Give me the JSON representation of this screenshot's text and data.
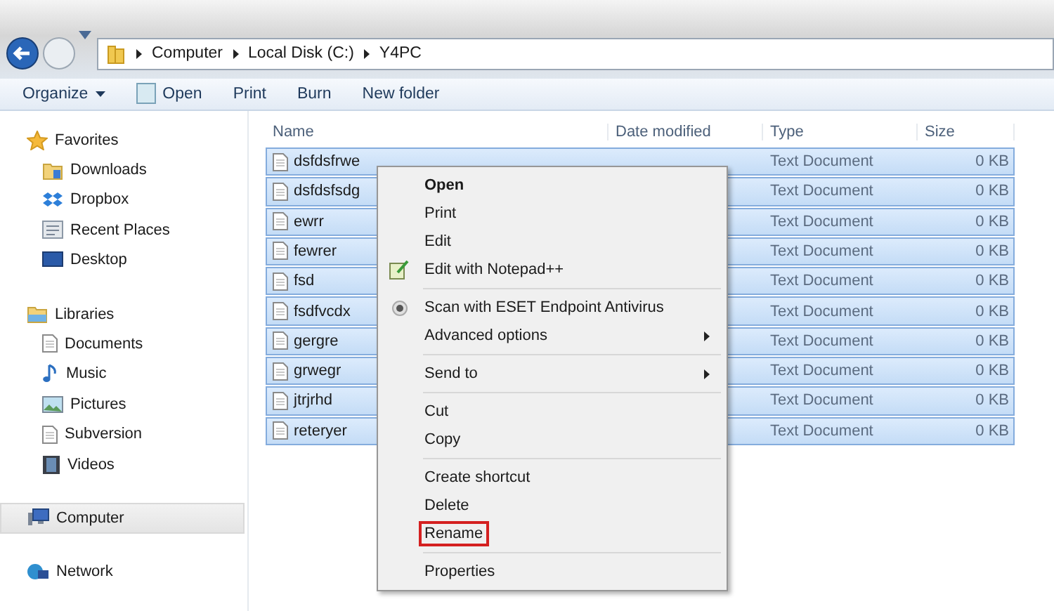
{
  "address_bar": {
    "crumbs": [
      "Computer",
      "Local Disk (C:)",
      "Y4PC"
    ]
  },
  "toolbar": {
    "items": [
      {
        "label": "Organize",
        "dropdown": true
      },
      {
        "label": "Open",
        "dropdown": false
      },
      {
        "label": "Print",
        "dropdown": false
      },
      {
        "label": "Burn",
        "dropdown": false
      },
      {
        "label": "New folder",
        "dropdown": false
      }
    ]
  },
  "sidebar": {
    "groups": [
      {
        "label": "Favorites",
        "selected": false,
        "children": [
          {
            "label": "Downloads",
            "selected": false
          },
          {
            "label": "Dropbox",
            "selected": false
          },
          {
            "label": "Recent Places",
            "selected": false
          },
          {
            "label": "Desktop",
            "selected": false
          }
        ]
      },
      {
        "label": "Libraries",
        "selected": false,
        "children": [
          {
            "label": "Documents",
            "selected": false
          },
          {
            "label": "Music",
            "selected": false
          },
          {
            "label": "Pictures",
            "selected": false
          },
          {
            "label": "Subversion",
            "selected": false
          },
          {
            "label": "Videos",
            "selected": false
          }
        ]
      },
      {
        "label": "Computer",
        "selected": true
      },
      {
        "label": "Network",
        "selected": false
      }
    ]
  },
  "table": {
    "columns": [
      "Name",
      "Date modified",
      "Type",
      "Size"
    ],
    "rows": [
      {
        "name": "dsfdsfrwe",
        "type": "Text Document",
        "size": "0 KB",
        "selected": true
      },
      {
        "name": "dsfdsfsdg",
        "type": "Text Document",
        "size": "0 KB",
        "selected": true
      },
      {
        "name": "ewrr",
        "type": "Text Document",
        "size": "0 KB",
        "selected": true
      },
      {
        "name": "fewrer",
        "type": "Text Document",
        "size": "0 KB",
        "selected": true
      },
      {
        "name": "fsd",
        "type": "Text Document",
        "size": "0 KB",
        "selected": true
      },
      {
        "name": "fsdfvcdx",
        "type": "Text Document",
        "size": "0 KB",
        "selected": true
      },
      {
        "name": "gergre",
        "type": "Text Document",
        "size": "0 KB",
        "selected": true
      },
      {
        "name": "grwegr",
        "type": "Text Document",
        "size": "0 KB",
        "selected": true
      },
      {
        "name": "jtrjrhd",
        "type": "Text Document",
        "size": "0 KB",
        "selected": true
      },
      {
        "name": "reteryer",
        "type": "Text Document",
        "size": "0 KB",
        "selected": true
      }
    ]
  },
  "context_menu": {
    "items": [
      {
        "kind": "plain",
        "label": "Open",
        "bold": true,
        "submenu": false,
        "highlighted": false
      },
      {
        "kind": "plain",
        "label": "Print",
        "bold": false,
        "submenu": false,
        "highlighted": false
      },
      {
        "kind": "plain",
        "label": "Edit",
        "bold": false,
        "submenu": false,
        "highlighted": false
      },
      {
        "kind": "notepad",
        "label": "Edit with Notepad++",
        "bold": false,
        "submenu": false,
        "highlighted": false
      },
      {
        "kind": "separator"
      },
      {
        "kind": "scan",
        "label": "Scan with ESET Endpoint Antivirus",
        "bold": false,
        "submenu": false,
        "highlighted": false
      },
      {
        "kind": "plain",
        "label": "Advanced options",
        "bold": false,
        "submenu": true,
        "highlighted": false
      },
      {
        "kind": "separator"
      },
      {
        "kind": "plain",
        "label": "Send to",
        "bold": false,
        "submenu": true,
        "highlighted": false
      },
      {
        "kind": "separator"
      },
      {
        "kind": "plain",
        "label": "Cut",
        "bold": false,
        "submenu": false,
        "highlighted": false
      },
      {
        "kind": "plain",
        "label": "Copy",
        "bold": false,
        "submenu": false,
        "highlighted": false
      },
      {
        "kind": "separator"
      },
      {
        "kind": "plain",
        "label": "Create shortcut",
        "bold": false,
        "submenu": false,
        "highlighted": false
      },
      {
        "kind": "plain",
        "label": "Delete",
        "bold": false,
        "submenu": false,
        "highlighted": false
      },
      {
        "kind": "plain",
        "label": "Rename",
        "bold": false,
        "submenu": false,
        "highlighted": true
      },
      {
        "kind": "separator"
      },
      {
        "kind": "plain",
        "label": "Properties",
        "bold": false,
        "submenu": false,
        "highlighted": false
      }
    ]
  }
}
